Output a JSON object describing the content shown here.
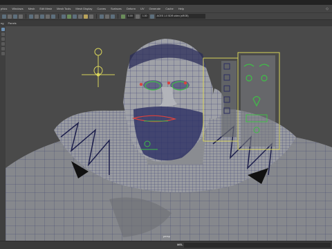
{
  "menubar": {
    "items": [
      "phics",
      "Windows",
      "Mesh",
      "Edit Mesh",
      "Mesh Tools",
      "Mesh Display",
      "Curves",
      "Surfaces",
      "Deform",
      "UV",
      "Generate",
      "Cache",
      "Help"
    ],
    "window_control": "◇"
  },
  "toolbar": {
    "field_a": "0.00",
    "field_b": "1.00",
    "renderer": "ACES 1.0 SDR-video (sRGB)"
  },
  "panel_menu": {
    "items": [
      "ng",
      "Panels"
    ]
  },
  "viewport": {
    "camera_label": "persp"
  },
  "status": {
    "mel_label": "MEL",
    "mel_input": ""
  },
  "colors": {
    "background": "#4a4a4a",
    "mesh_fill": "#8b8d92",
    "wire": "#2c2f6e",
    "control_yellow": "#d8d45a",
    "control_green": "#3fbf46",
    "control_red": "#d8443f",
    "menubar": "#444444"
  }
}
